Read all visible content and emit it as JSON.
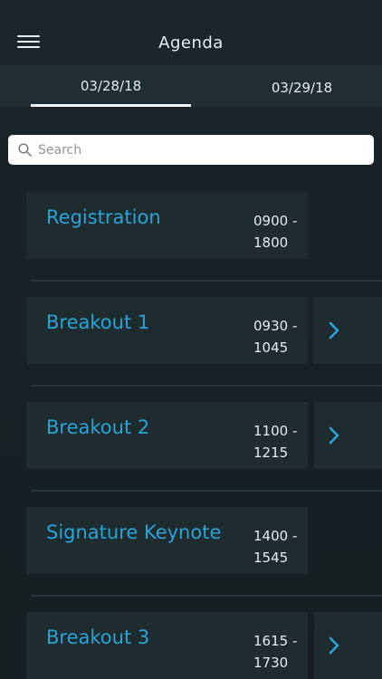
{
  "header": {
    "title": "Agenda",
    "menu_icon": "hamburger-menu-icon"
  },
  "tabs": [
    {
      "label": "03/28/18",
      "selected": true
    },
    {
      "label": "03/29/18",
      "selected": false
    }
  ],
  "search": {
    "placeholder": "Search",
    "value": "",
    "icon": "search-icon"
  },
  "sessions": [
    {
      "title": "Registration",
      "time_start": "0900 -",
      "time_end": "1800",
      "has_detail": false
    },
    {
      "title": "Breakout 1",
      "time_start": "0930 -",
      "time_end": "1045",
      "has_detail": true
    },
    {
      "title": "Breakout 2",
      "time_start": "1100 -",
      "time_end": "1215",
      "has_detail": true
    },
    {
      "title": "Signature Keynote",
      "time_start": "1400 -",
      "time_end": "1545",
      "has_detail": false
    },
    {
      "title": "Breakout 3",
      "time_start": "1615 -",
      "time_end": "1730",
      "has_detail": true
    }
  ],
  "colors": {
    "accent": "#2aa3d8",
    "background": "#172226",
    "card": "#1e2b2f",
    "tab_bar": "#1f2e32"
  }
}
